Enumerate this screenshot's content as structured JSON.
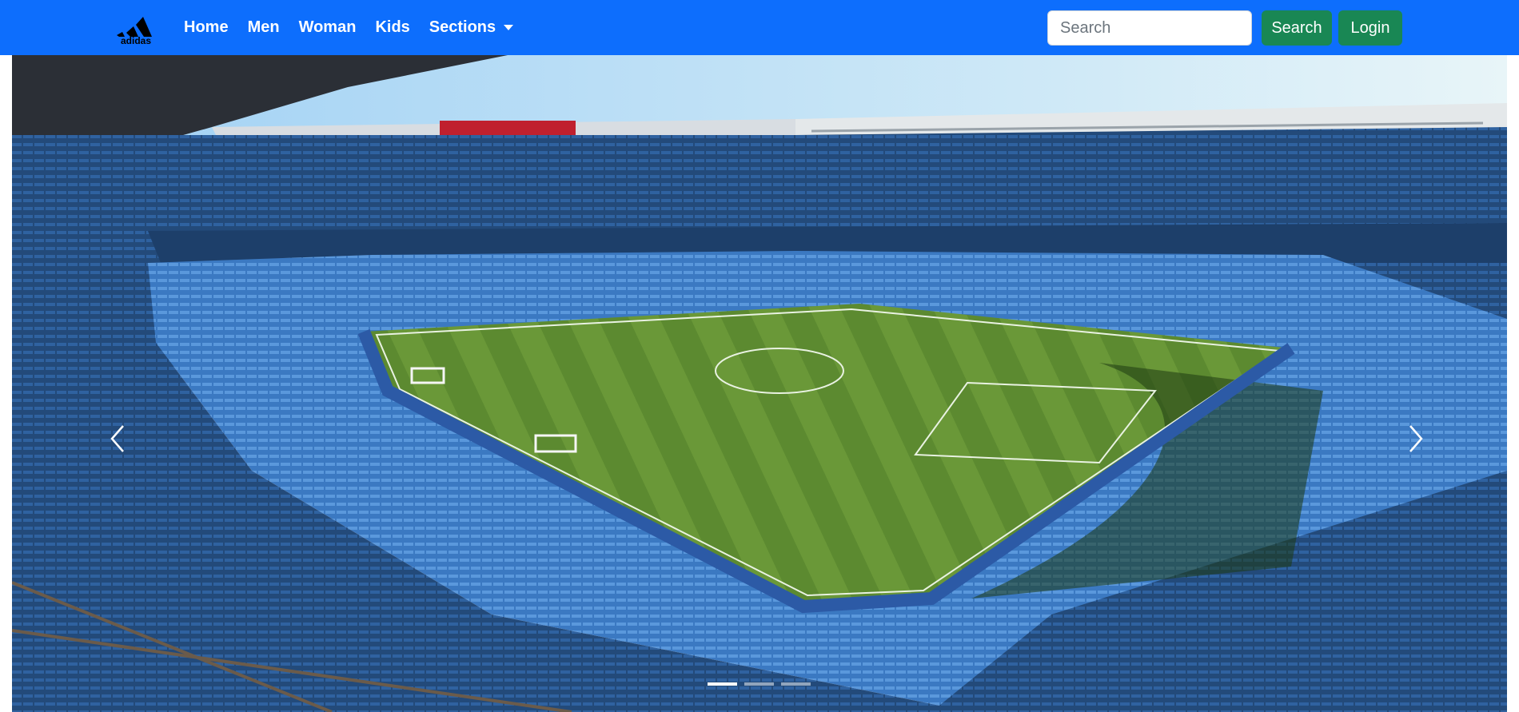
{
  "brand": {
    "name": "adidas"
  },
  "nav": {
    "items": [
      {
        "label": "Home"
      },
      {
        "label": "Men"
      },
      {
        "label": "Woman"
      },
      {
        "label": "Kids"
      },
      {
        "label": "Sections"
      }
    ]
  },
  "search": {
    "placeholder": "Search",
    "value": ""
  },
  "buttons": {
    "search": "Search",
    "login": "Login"
  },
  "carousel": {
    "slide_description_icon": "stadium-photo",
    "slides_count": 3,
    "active_slide": 1
  },
  "colors": {
    "navbar": "#0d6efd",
    "button": "#198754",
    "nav_text": "#ffffff"
  }
}
